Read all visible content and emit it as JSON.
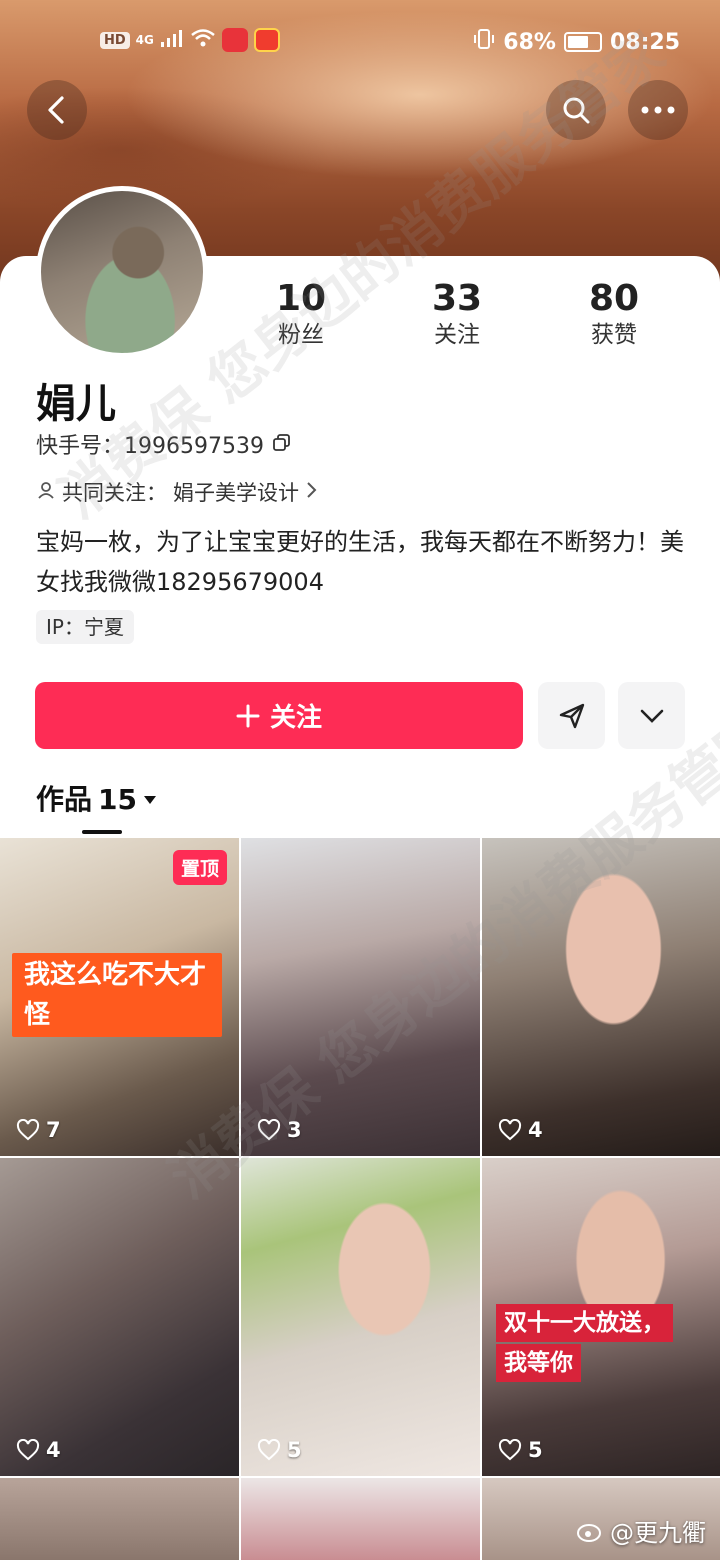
{
  "status_bar": {
    "left_labels": [
      "HD",
      "4G"
    ],
    "battery": "68%",
    "battery_level": 0.68,
    "time": "08:25"
  },
  "profile": {
    "stats": [
      {
        "num": "10",
        "label": "粉丝"
      },
      {
        "num": "33",
        "label": "关注"
      },
      {
        "num": "80",
        "label": "获赞"
      }
    ],
    "name": "娟儿",
    "id_label": "快手号：",
    "id_value": "1996597539",
    "mutual_label": "共同关注：",
    "mutual_value": "娟子美学设计",
    "bio": "宝妈一枚，为了让宝宝更好的生活，我每天都在不断努力！美女找我微微18295679004",
    "ip": "IP：宁夏"
  },
  "actions": {
    "follow_label": "关注"
  },
  "works": {
    "tab_label": "作品",
    "count": "15"
  },
  "grid": [
    {
      "likes": "7",
      "pin": "置顶",
      "caption": "我这么吃不大才怪"
    },
    {
      "likes": "3"
    },
    {
      "likes": "4"
    },
    {
      "likes": "4"
    },
    {
      "likes": "5"
    },
    {
      "likes": "5",
      "caption_line1": "双十一大放送，",
      "caption_line2": "我等你"
    }
  ],
  "watermark": {
    "text": "@更九衢",
    "overlay": "消费保 您身边的消费服务管家"
  },
  "colors": {
    "accent": "#fe2c55",
    "caption_orange": "#ff5a1e",
    "caption_red": "#d8233a"
  }
}
